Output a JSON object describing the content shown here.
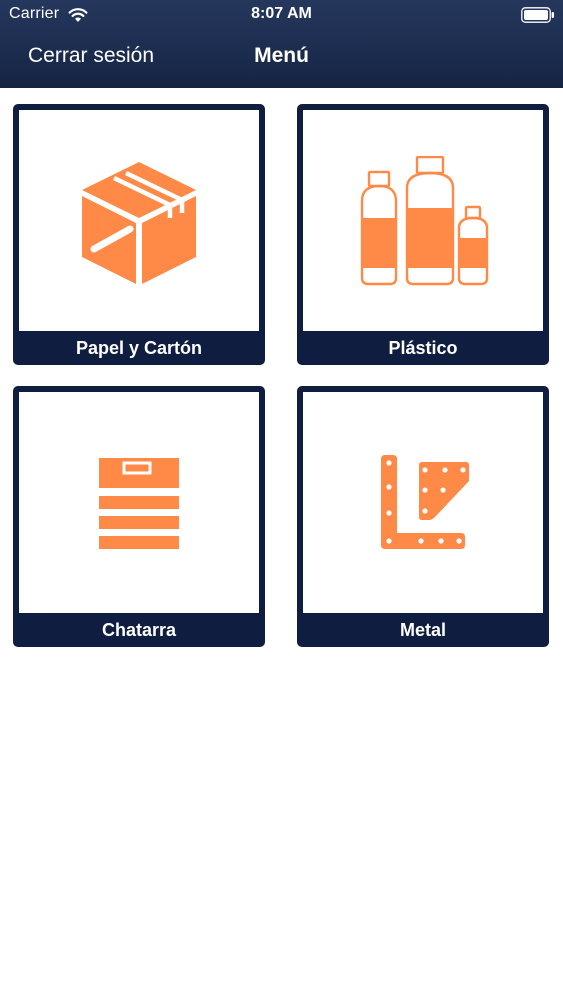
{
  "status_bar": {
    "carrier": "Carrier",
    "time": "8:07 AM"
  },
  "nav": {
    "logout_label": "Cerrar sesión",
    "title": "Menú"
  },
  "colors": {
    "navy": "#0f1d40",
    "accent": "#ff8a47",
    "background": "#ffffff"
  },
  "tiles": [
    {
      "label": "Papel y Cartón",
      "icon": "cardboard-box-icon"
    },
    {
      "label": "Plástico",
      "icon": "plastic-bottles-icon"
    },
    {
      "label": "Chatarra",
      "icon": "scrap-stack-icon"
    },
    {
      "label": "Metal",
      "icon": "metal-brackets-icon"
    }
  ]
}
